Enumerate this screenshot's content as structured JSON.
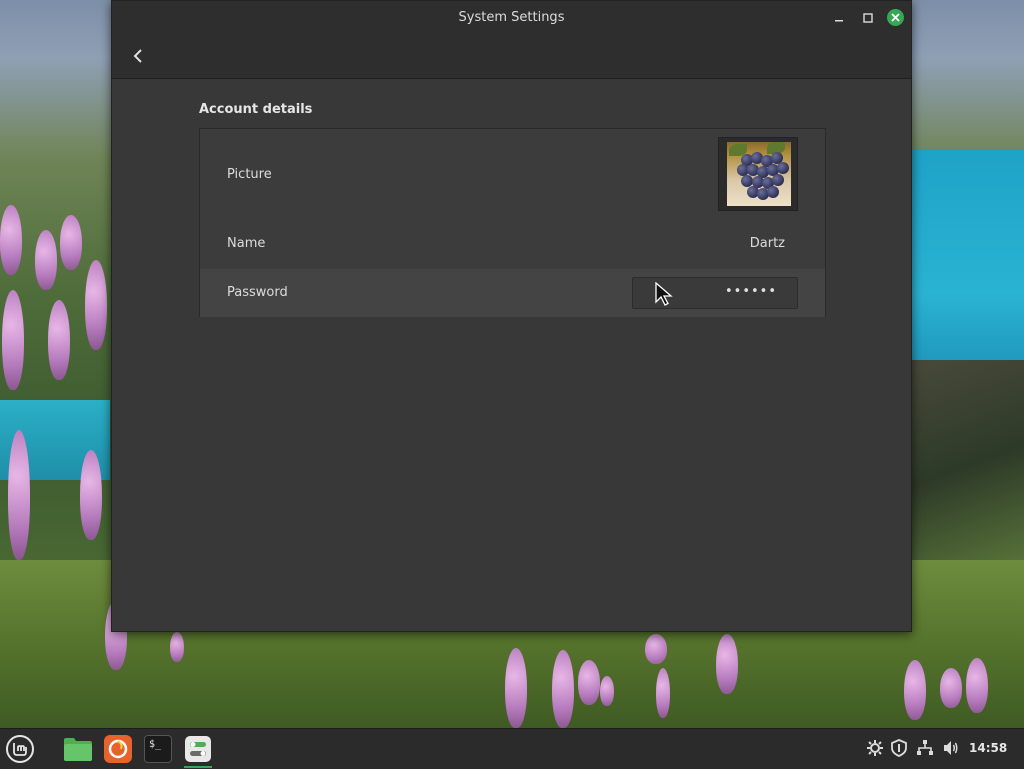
{
  "window": {
    "title": "System Settings",
    "minimize_symbol": "—",
    "maximize_symbol": "☐",
    "close_symbol": "✕"
  },
  "header": {
    "back_icon": "chevron-left-icon"
  },
  "account": {
    "section_title": "Account details",
    "picture_label": "Picture",
    "name_label": "Name",
    "name_value": "Dartz",
    "password_label": "Password",
    "password_value": "••••••"
  },
  "taskbar": {
    "items": [
      {
        "icon": "linux-mint-menu-icon"
      },
      {
        "icon": "files-folder-icon"
      },
      {
        "icon": "firefox-icon"
      },
      {
        "icon": "terminal-icon"
      },
      {
        "icon": "system-settings-icon",
        "active": true
      }
    ],
    "tray": [
      {
        "icon": "network-settings-icon"
      },
      {
        "icon": "shield-icon"
      },
      {
        "icon": "wired-network-icon"
      },
      {
        "icon": "volume-icon"
      }
    ],
    "clock": "14:58",
    "terminal_prompt": "$_"
  },
  "colors": {
    "accent": "#35a854",
    "window_bg": "#383838",
    "titlebar_bg": "#2e2e2e",
    "panel_bg": "#3c3c3c",
    "taskbar_bg": "#2b2b2b"
  }
}
